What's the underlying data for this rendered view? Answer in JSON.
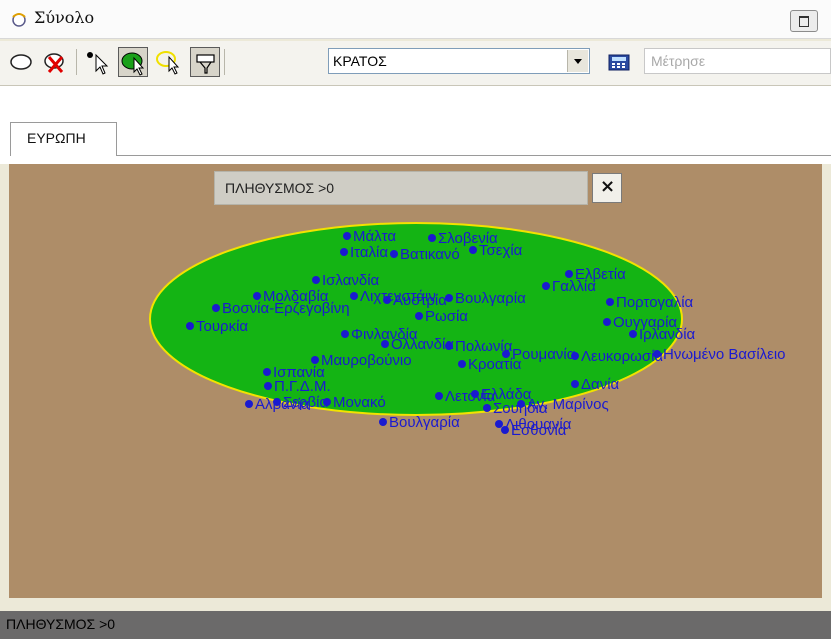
{
  "window": {
    "title": "Σύνολο"
  },
  "toolbar": {
    "tools": [
      "ellipse-select",
      "clear-selection",
      "select-pointer",
      "region-select",
      "highlight-select",
      "filter"
    ],
    "layer_value": "ΚΡΑΤΟΣ",
    "measure_placeholder": "Μέτρησε"
  },
  "tabs": [
    {
      "label": "ΕΥΡΩΠΗ",
      "active": true
    }
  ],
  "filter": {
    "label": "ΠΛΗΘΥΣΜΟΣ >0",
    "close": "×"
  },
  "map": {
    "background": "#ae8d68",
    "ellipse_fill": "#14b414",
    "ellipse_stroke": "#f2e200",
    "dot_color": "#1a1ad0",
    "countries": [
      "Μάλτα",
      "Σλοβενία",
      "Ιταλία",
      "Βατικανό",
      "Τσεχία",
      "Ισλανδία",
      "Ελβετία",
      "Μολδαβία",
      "Λιχτενστάιν",
      "Βουλγαρία",
      "Γαλλία",
      "Βοσνία-Ερζεγοβίνη",
      "Αυστρία",
      "Πορτογαλία",
      "Τουρκία",
      "Ρωσία",
      "Ουγγαρία",
      "Φινλανδία",
      "Ολλανδία",
      "Πολωνία",
      "Ιρλανδία",
      "Ρουμανία",
      "Λευκορωσία",
      "Ηνωμένο Βασίλειο",
      "Μαυροβούνιο",
      "Κροατία",
      "Ισπανία",
      "Δανία",
      "Π.Γ.Δ.Μ.",
      "Ελλάδα",
      "Αλβανία",
      "Μονακό",
      "Λετονία",
      "Σερβία",
      "Σουηδία",
      "Αγ. Μαρίνος",
      "Βουλγαρία",
      "Λιθουανία",
      "Εσθονία"
    ]
  },
  "status": {
    "text": "ΠΛΗΘΥΣΜΟΣ >0"
  }
}
